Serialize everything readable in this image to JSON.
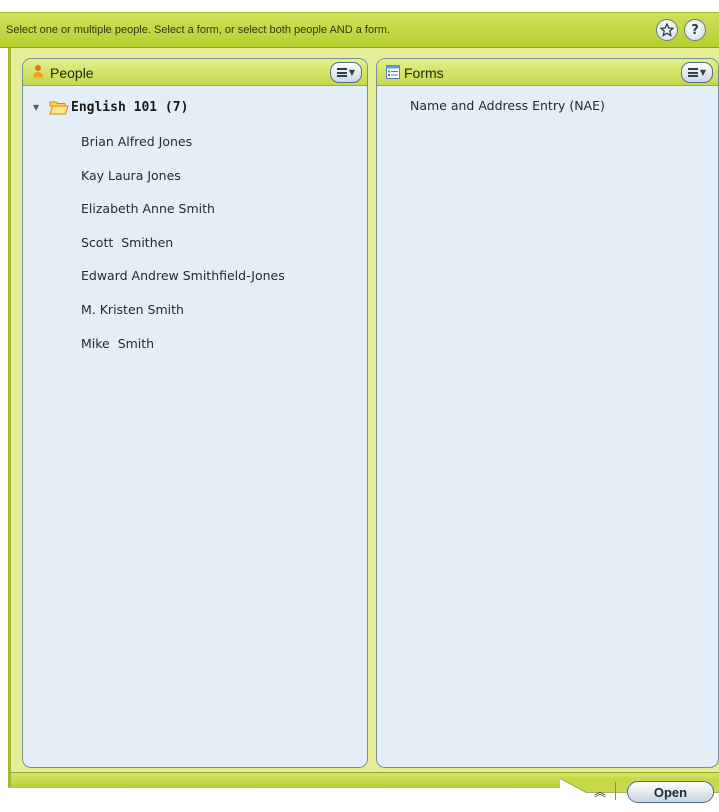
{
  "topbar": {
    "instruction": "Select one or multiple people.  Select a form, or select both people AND a form.",
    "favorite_icon": "star-icon",
    "help_icon": "question-icon",
    "help_label": "?"
  },
  "people_panel": {
    "title": "People",
    "icon": "person-icon",
    "menu_icon": "list-menu-icon",
    "group": {
      "label": "English 101 (7)",
      "expanded": true
    },
    "people": [
      "Brian Alfred Jones",
      "Kay Laura Jones",
      "Elizabeth Anne Smith",
      "Scott  Smithen",
      "Edward Andrew Smithfield-Jones",
      "M. Kristen Smith",
      "Mike  Smith"
    ]
  },
  "forms_panel": {
    "title": "Forms",
    "icon": "form-icon",
    "menu_icon": "list-menu-icon",
    "forms": [
      "Name and Address Entry (NAE)"
    ]
  },
  "bottombar": {
    "collapse_icon": "double-chevron-up-icon",
    "open_label": "Open"
  },
  "colors": {
    "accent_green": "#c4d84a",
    "panel_background": "#e3eef7",
    "folder": "#f0a020"
  }
}
